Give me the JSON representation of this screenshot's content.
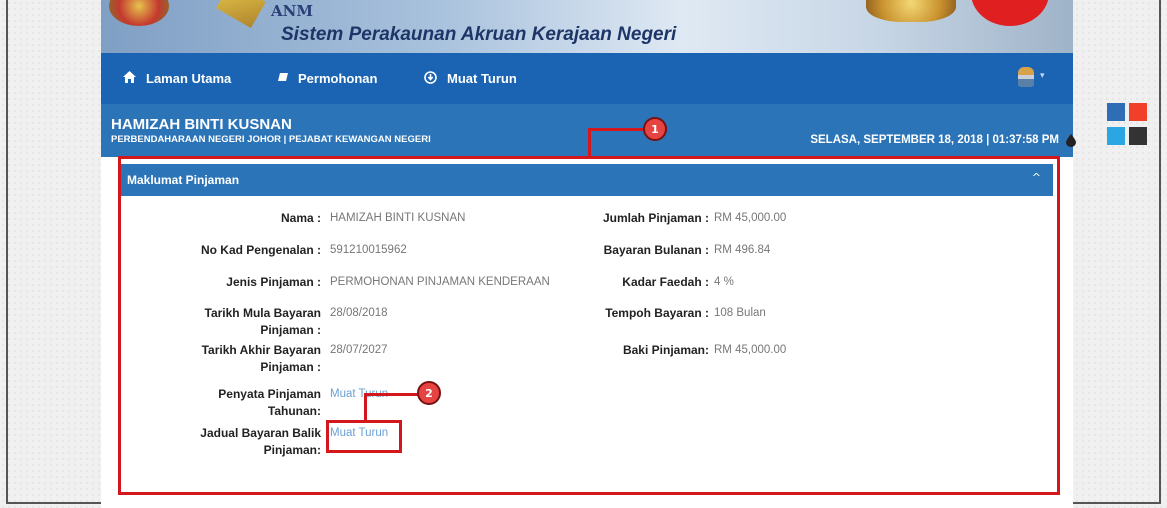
{
  "banner": {
    "org": "ANM",
    "title": "Sistem Perakaunan Akruan Kerajaan Negeri"
  },
  "nav": {
    "items": [
      {
        "label": "Laman Utama",
        "icon": "home-icon"
      },
      {
        "label": "Permohonan",
        "icon": "edit-icon"
      },
      {
        "label": "Muat Turun",
        "icon": "download-circle-icon"
      }
    ],
    "user_icon": "user-avatar-icon"
  },
  "profile": {
    "name": "HAMIZAH BINTI KUSNAN",
    "org": "PERBENDAHARAAN NEGERI JOHOR | PEJABAT KEWANGAN NEGERI",
    "datetime": "SELASA, SEPTEMBER 18, 2018 | 01:37:58 PM"
  },
  "panel": {
    "title": "Maklumat Pinjaman",
    "left": [
      {
        "label": "Nama :",
        "value": "HAMIZAH BINTI KUSNAN"
      },
      {
        "label": "No Kad Pengenalan :",
        "value": "591210015962"
      },
      {
        "label": "Jenis Pinjaman :",
        "value": "PERMOHONAN PINJAMAN KENDERAAN"
      },
      {
        "label_line1": "Tarikh Mula Bayaran",
        "label_line2": "Pinjaman :",
        "value": "28/08/2018"
      },
      {
        "label_line1": "Tarikh Akhir Bayaran",
        "label_line2": "Pinjaman :",
        "value": "28/07/2027"
      },
      {
        "label_line1": "Penyata Pinjaman",
        "label_line2": "Tahunan:",
        "value": "Muat Turun"
      },
      {
        "label_line1": "Jadual Bayaran Balik",
        "label_line2": "Pinjaman:",
        "value": "Muat Turun"
      }
    ],
    "right": [
      {
        "label": "Jumlah Pinjaman :",
        "value": "RM 45,000.00"
      },
      {
        "label": "Bayaran Bulanan :",
        "value": "RM 496.84"
      },
      {
        "label": "Kadar Faedah :",
        "value": "4 %"
      },
      {
        "label": "Tempoh Bayaran :",
        "value": "108 Bulan"
      },
      {
        "label": "Baki Pinjaman:",
        "value": "RM 45,000.00"
      }
    ]
  },
  "annotations": {
    "badge1": "1",
    "badge2": "2"
  },
  "theme": {
    "swatches": [
      "#2f6db5",
      "#f0402a",
      "#2aa7e3",
      "#333333"
    ],
    "accent": "#d4161d"
  }
}
